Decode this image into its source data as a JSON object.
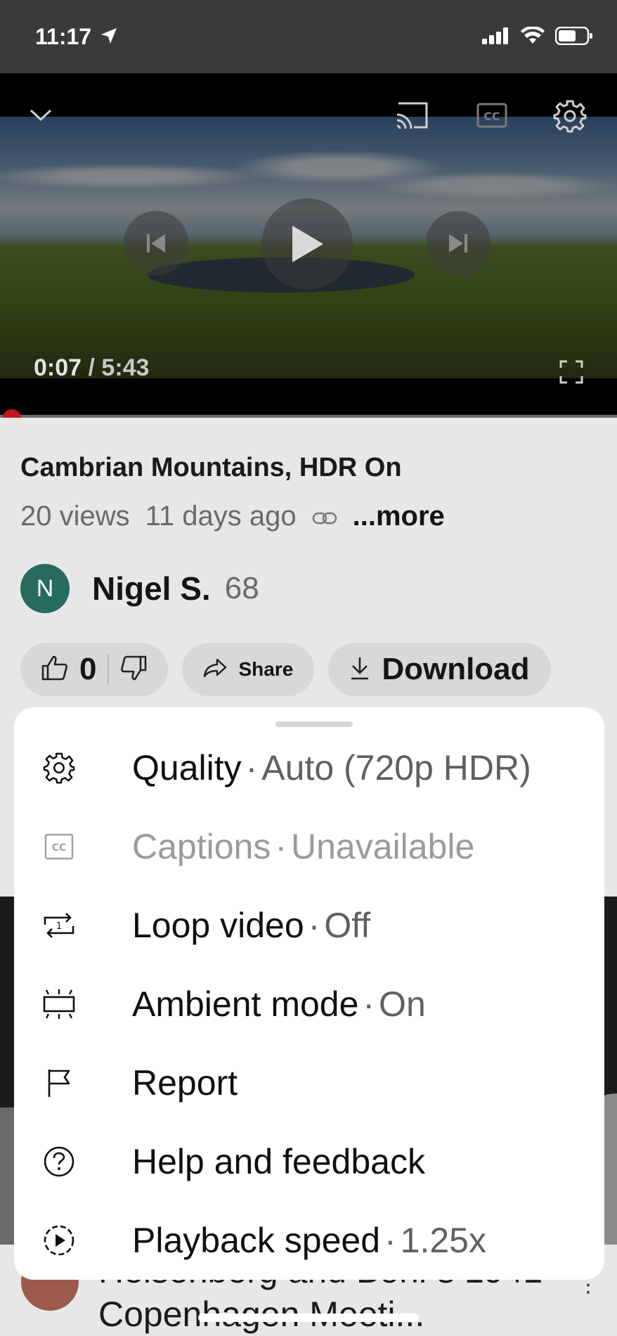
{
  "status_bar": {
    "time": "11:17"
  },
  "player": {
    "current_time": "0:07",
    "duration": "/ 5:43",
    "progress": 0.02
  },
  "video": {
    "title": "Cambrian Mountains, HDR On",
    "views": "20 views",
    "age": "11 days ago",
    "more": "...more"
  },
  "channel": {
    "avatar_letter": "N",
    "name": "Nigel S.",
    "subscribers": "68"
  },
  "actions": {
    "likes": "0",
    "share": "Share",
    "download": "Download"
  },
  "sheet": {
    "items": [
      {
        "label": "Quality",
        "value": "Auto (720p HDR)",
        "icon": "gear-icon"
      },
      {
        "label": "Captions",
        "value": "Unavailable",
        "icon": "captions-icon"
      },
      {
        "label": "Loop video",
        "value": "Off",
        "icon": "loop-icon"
      },
      {
        "label": "Ambient mode",
        "value": "On",
        "icon": "ambient-icon"
      },
      {
        "label": "Report",
        "icon": "flag-icon"
      },
      {
        "label": "Help and feedback",
        "icon": "help-icon"
      },
      {
        "label": "Playback speed",
        "value": "1.25x",
        "icon": "speed-icon"
      }
    ],
    "separator": "·"
  },
  "next_video": {
    "title": "Heisenberg and Bohr's 1941 Copenhagen Meeti..."
  }
}
